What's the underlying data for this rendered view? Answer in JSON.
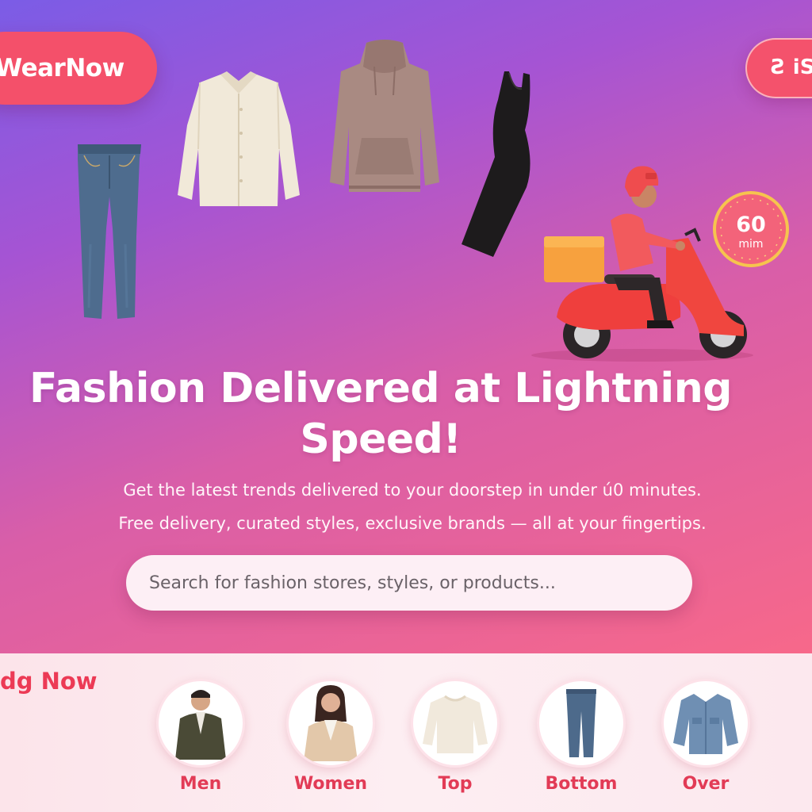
{
  "header": {
    "brand": "WearNow",
    "top_right_label": "Ƨ iS"
  },
  "hero": {
    "headline": "Fashion Delivered at Lightning Speed!",
    "subline_1": "Get the latest trends delivered to your doorstep in under ú0 minutes.",
    "subline_2": "Free delivery, curated styles, exclusive brands — all at your fingertips.",
    "timer": {
      "value": "60",
      "unit": "mim"
    }
  },
  "search": {
    "placeholder": "Search for fashion stores, styles, or products..."
  },
  "categories_section": {
    "title": "dg Now",
    "items": [
      {
        "label": "Men",
        "icon": "men-jacket-icon"
      },
      {
        "label": "Women",
        "icon": "women-cardigan-icon"
      },
      {
        "label": "Top",
        "icon": "sweater-icon"
      },
      {
        "label": "Bottom",
        "icon": "jeans-icon"
      },
      {
        "label": "Over",
        "icon": "denim-jacket-icon"
      }
    ]
  },
  "colors": {
    "brand": "#f4506a",
    "accent_text": "#e23b56",
    "hero_gradient_start": "#7b5ce6",
    "hero_gradient_end": "#f7688a"
  }
}
